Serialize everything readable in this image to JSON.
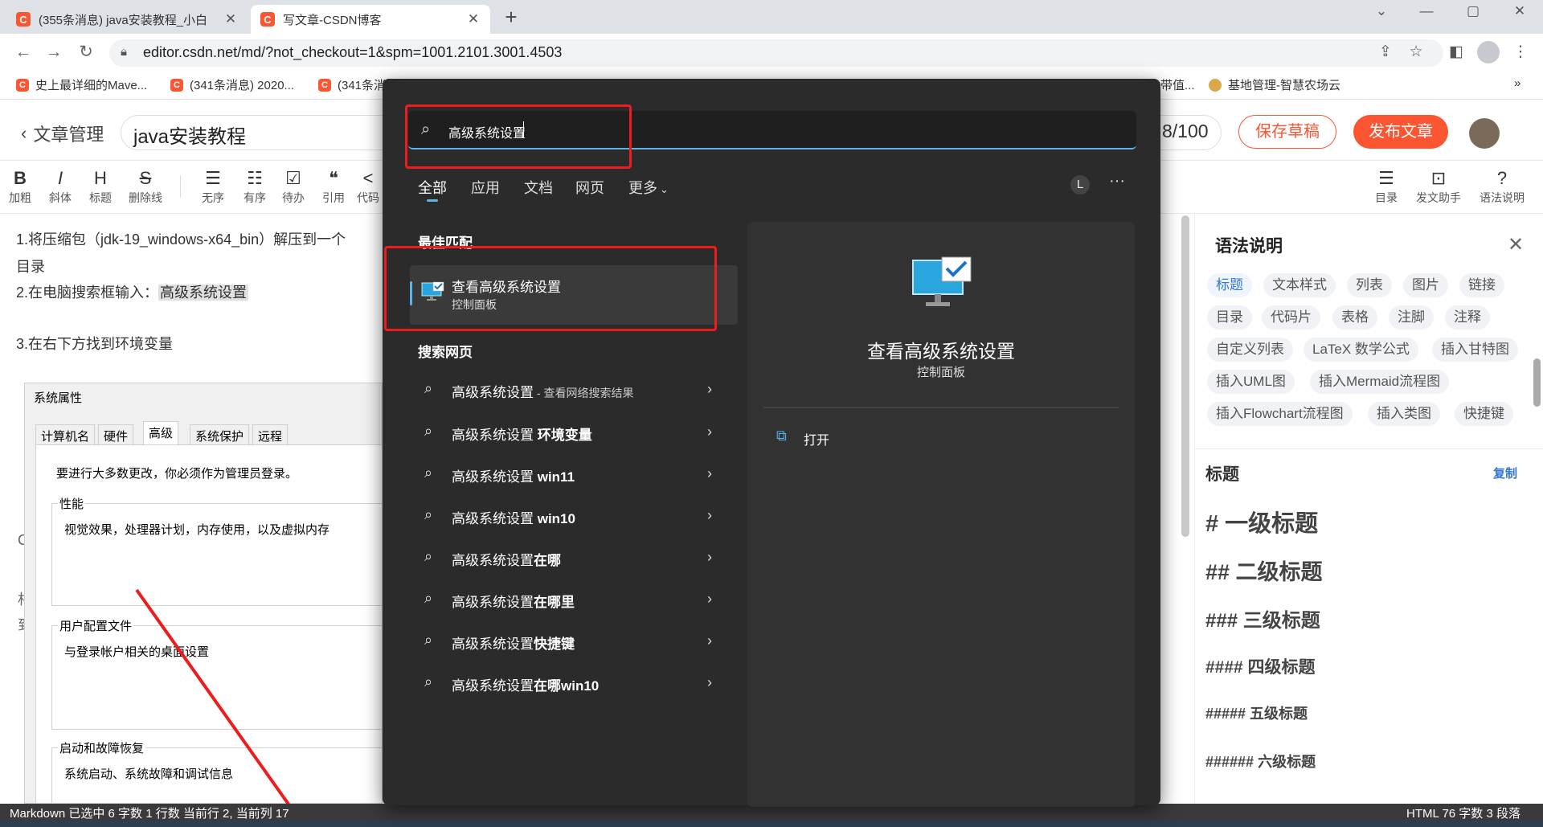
{
  "browser": {
    "tabs": [
      {
        "icon_letter": "C",
        "title": "(355条消息) java安装教程_小白"
      },
      {
        "icon_letter": "C",
        "title": "写文章-CSDN博客"
      }
    ],
    "new_tab_label": "+",
    "window_controls": {
      "minimize": "—",
      "maximize": "▢",
      "close": "✕",
      "dropdown": "⌄"
    },
    "url": "editor.csdn.net/md/?not_checkout=1&spm=1001.2101.3001.4503",
    "bookmarks": [
      {
        "icon_letter": "C",
        "label": "史上最详细的Mave..."
      },
      {
        "icon_letter": "C",
        "label": "(341条消息) 2020..."
      },
      {
        "icon_letter": "C",
        "label": "(341条消"
      },
      {
        "icon_letter": "",
        "label": "带值..."
      },
      {
        "icon_letter": "",
        "label": "基地管理-智慧农场云"
      }
    ],
    "bookmarks_overflow": "»"
  },
  "editor": {
    "back_label": "文章管理",
    "title_value": "java安装教程",
    "title_counter": "8/100",
    "save_draft_label": "保存草稿",
    "publish_label": "发布文章",
    "toolbar_left": [
      {
        "glyph": "B",
        "label": "加粗"
      },
      {
        "glyph": "I",
        "label": "斜体"
      },
      {
        "glyph": "H",
        "label": "标题"
      },
      {
        "glyph": "S",
        "label": "删除线"
      },
      {
        "glyph": "☰",
        "label": "无序"
      },
      {
        "glyph": "☷",
        "label": "有序"
      },
      {
        "glyph": "☑",
        "label": "待办"
      },
      {
        "glyph": "❝",
        "label": "引用"
      },
      {
        "glyph": "<",
        "label": "代码"
      }
    ],
    "toolbar_right": [
      {
        "glyph": "☰",
        "label": "目录"
      },
      {
        "glyph": "⊡",
        "label": "发文助手"
      },
      {
        "glyph": "?",
        "label": "语法说明"
      }
    ],
    "content": {
      "line1": "1.将压缩包（jdk-19_windows-x64_bin）解压到一个",
      "line1b": "目录",
      "line2_prefix": "2.在电脑搜索框输入：",
      "line2_highlight": "高级系统设置",
      "line3": "3.在右下方找到环境变量",
      "stray_chars": [
        "C",
        "相",
        "到"
      ]
    }
  },
  "system_properties": {
    "title": "系统属性",
    "tabs": [
      "计算机名",
      "硬件",
      "高级",
      "系统保护",
      "远程"
    ],
    "selected_tab": "高级",
    "admin_note": "要进行大多数更改，你必须作为管理员登录。",
    "performance_title": "性能",
    "performance_desc": "视觉效果，处理器计划，内存使用，以及虚拟内存",
    "profile_title": "用户配置文件",
    "profile_desc": "与登录帐户相关的桌面设置",
    "startup_title": "启动和故障恢复",
    "startup_desc": "系统启动、系统故障和调试信息"
  },
  "grammar_panel": {
    "title": "语法说明",
    "close": "✕",
    "tags": [
      "标题",
      "文本样式",
      "列表",
      "图片",
      "链接",
      "目录",
      "代码片",
      "表格",
      "注脚",
      "注释",
      "自定义列表",
      "LaTeX 数学公式",
      "插入甘特图",
      "插入UML图",
      "插入Mermaid流程图",
      "插入Flowchart流程图",
      "插入类图",
      "快捷键"
    ],
    "active_tag": "标题",
    "section_title": "标题",
    "copy_label": "复制",
    "headings": [
      "# 一级标题",
      "## 二级标题",
      "### 三级标题",
      "#### 四级标题",
      "##### 五级标题",
      "###### 六级标题"
    ]
  },
  "status_bar": {
    "left": "Markdown 已选中   6 字数   1 行数   当前行 2, 当前列 17",
    "right": "HTML  76 字数  3 段落"
  },
  "windows_search": {
    "query": "高级系统设置",
    "filters": [
      "全部",
      "应用",
      "文档",
      "网页",
      "更多"
    ],
    "active_filter": "全部",
    "user_initial": "L",
    "more_menu": "···",
    "best_match_header": "最佳匹配",
    "best_match": {
      "title": "查看高级系统设置",
      "subtitle": "控制面板"
    },
    "web_header": "搜索网页",
    "web_results": [
      {
        "plain": "高级系统设置",
        "bold": "",
        "suffix": " - 查看网络搜索结果"
      },
      {
        "plain": "高级系统设置",
        "bold": " 环境变量",
        "suffix": ""
      },
      {
        "plain": "高级系统设置",
        "bold": " win11",
        "suffix": ""
      },
      {
        "plain": "高级系统设置",
        "bold": " win10",
        "suffix": ""
      },
      {
        "plain": "高级系统设置",
        "bold": "在哪",
        "suffix": ""
      },
      {
        "plain": "高级系统设置",
        "bold": "在哪里",
        "suffix": ""
      },
      {
        "plain": "高级系统设置",
        "bold": "快捷键",
        "suffix": ""
      },
      {
        "plain": "高级系统设置",
        "bold": "在哪win10",
        "suffix": ""
      }
    ],
    "preview": {
      "title": "查看高级系统设置",
      "subtitle": "控制面板",
      "action": "打开"
    }
  },
  "colors": {
    "brand": "#fc5531",
    "accent": "#5ab4e8",
    "annotation": "#ee1c1c"
  }
}
